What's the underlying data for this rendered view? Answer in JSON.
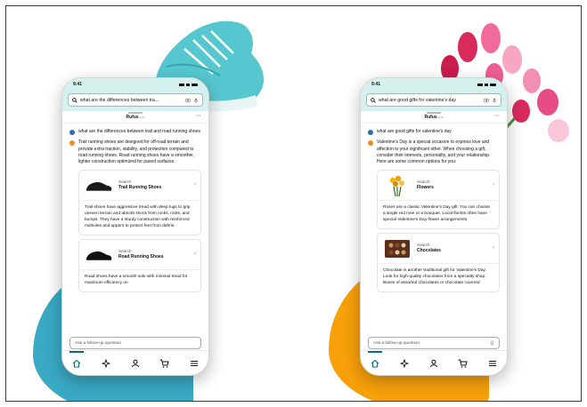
{
  "accent": "#007185",
  "phones": [
    {
      "status_time": "9:41",
      "search_query": "what are the differences between tra...",
      "assistant_name": "Rufus",
      "assistant_beta": "beta",
      "user_question": "what are the differences between trail and road running shoes",
      "ai_intro": "Trail running shoes are designed for off-road terrain and provide extra traction, stability, and protection compared to road running shoes. Road running shoes have a smoother, lighter construction optimized for paved surfaces.",
      "cards": [
        {
          "search_label": "Search",
          "title": "Trail Running Shoes",
          "body": "Trail shoes have aggressive tread with deep lugs to grip uneven terrain and absorb shock from rocks, roots, and bumps. They have a sturdy construction with reinforced midsoles and uppers to protect feet from debris."
        },
        {
          "search_label": "Search",
          "title": "Road Running Shoes",
          "body": "Road shoes have a smooth sole with minimal tread for maximum efficiency on"
        }
      ],
      "followup_placeholder": "Ask a follow-up question"
    },
    {
      "status_time": "9:41",
      "search_query": "what are good gifts for valentine's day",
      "assistant_name": "Rufus",
      "assistant_beta": "beta",
      "user_question": "what are good gifts for valentine's day",
      "ai_intro": "Valentine's Day is a special occasion to express love and affection to your significant other. When choosing a gift, consider their interests, personality, and your relationship. Here are some common options for you:",
      "cards": [
        {
          "search_label": "Search",
          "title": "Flowers",
          "body": "Roses are a classic Valentine's Day gift. You can choose a single red rose or a bouquet. Local florists often have special Valentine's Day flower arrangements."
        },
        {
          "search_label": "Search",
          "title": "Chocolates",
          "body": "Chocolate is another traditional gift for Valentine's Day. Look for high-quality chocolates from a specialty shop. Boxes of assorted chocolates or chocolate covered"
        }
      ],
      "followup_placeholder": "Ask a follow-up question"
    }
  ],
  "icons": [
    "search-icon",
    "camera-icon",
    "mic-icon",
    "home-icon",
    "rufus-icon",
    "account-icon",
    "cart-icon",
    "menu-icon",
    "chevron-right-icon",
    "more-icon"
  ]
}
